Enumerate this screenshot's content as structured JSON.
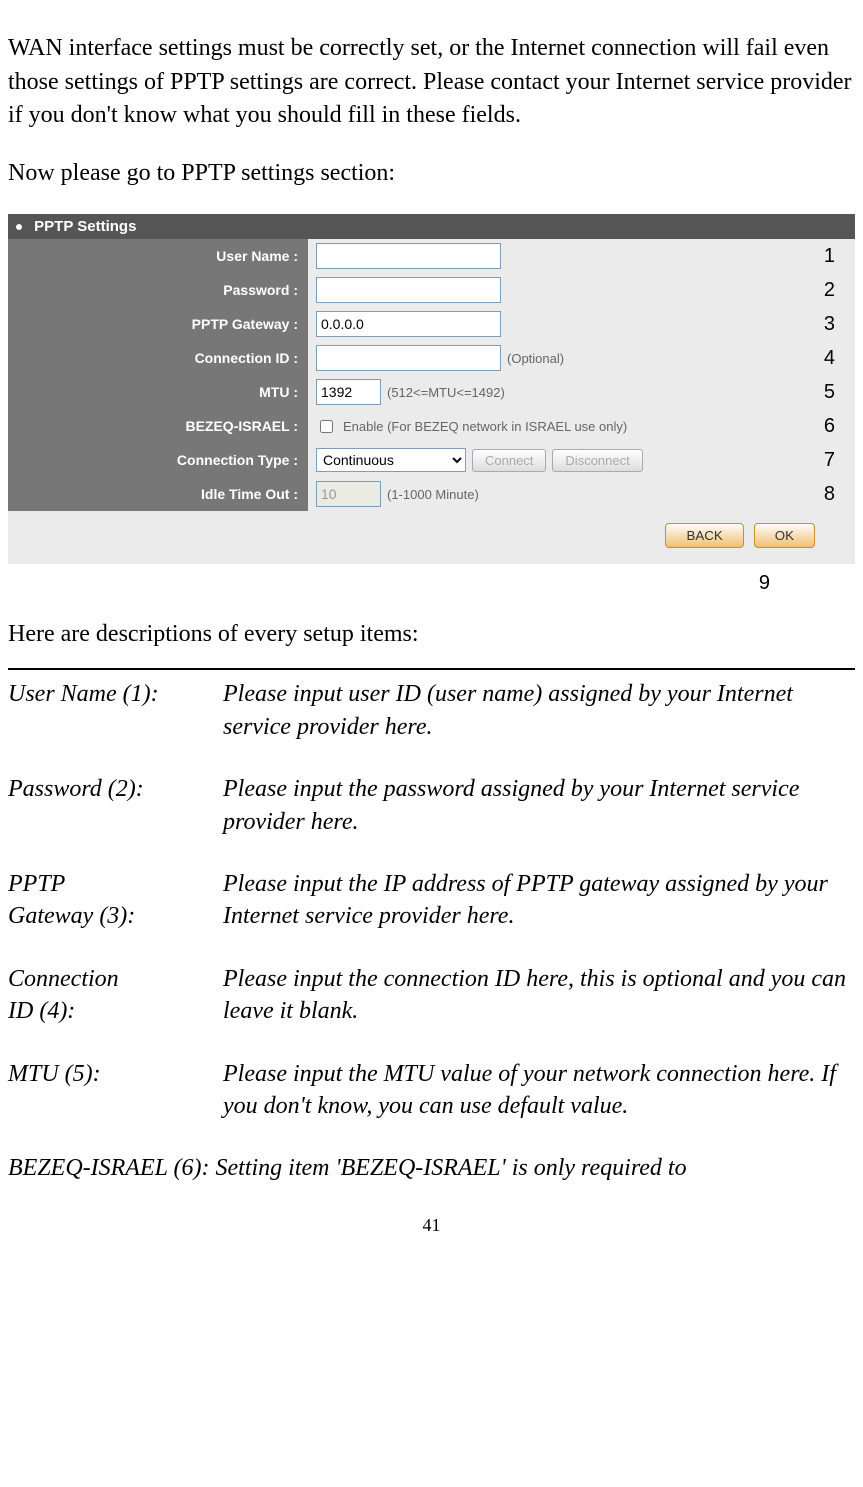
{
  "intro_p1": "WAN interface settings must be correctly set, or the Internet connection will fail even those settings of PPTP settings are correct. Please contact your Internet service provider if you don't know what you should fill in these fields.",
  "intro_p2": "Now please go to PPTP settings section:",
  "panel": {
    "title": "PPTP Settings",
    "rows": {
      "username": {
        "label": "User Name :",
        "value": "",
        "ann": "1"
      },
      "password": {
        "label": "Password :",
        "value": "",
        "ann": "2"
      },
      "gateway": {
        "label": "PPTP Gateway :",
        "value": "0.0.0.0",
        "ann": "3"
      },
      "connid": {
        "label": "Connection ID :",
        "value": "",
        "hint": "(Optional)",
        "ann": "4"
      },
      "mtu": {
        "label": "MTU :",
        "value": "1392",
        "hint": "(512<=MTU<=1492)",
        "ann": "5"
      },
      "bezeq": {
        "label": "BEZEQ-ISRAEL :",
        "hint": "Enable (For BEZEQ network in ISRAEL use only)",
        "ann": "6"
      },
      "conntype": {
        "label": "Connection Type :",
        "value": "Continuous",
        "connect": "Connect",
        "disconnect": "Disconnect",
        "ann": "7"
      },
      "idle": {
        "label": "Idle Time Out :",
        "value": "10",
        "hint": "(1-1000 Minute)",
        "ann": "8"
      }
    },
    "back": "BACK",
    "ok": "OK",
    "ann9": "9"
  },
  "desc_header": "Here are descriptions of every setup items:",
  "descriptions": [
    {
      "label": "User Name (1):",
      "text": "Please input user ID (user name) assigned by your Internet service provider here."
    },
    {
      "label": "Password (2):",
      "text": "Please input the password assigned by your Internet service provider here."
    },
    {
      "label": "PPTP Gateway (3):",
      "text": "Please input the IP address of PPTP gateway assigned by your Internet service provider here."
    },
    {
      "label": "Connection ID (4):",
      "text": "Please input the connection ID here, this is optional and you can leave it blank."
    },
    {
      "label": "MTU (5):",
      "text": "Please input the MTU value of your network connection here. If you don't know, you can use default value."
    },
    {
      "label": "BEZEQ-ISRAEL (6):",
      "text": "Setting item 'BEZEQ-ISRAEL' is only required to"
    }
  ],
  "page_num": "41"
}
